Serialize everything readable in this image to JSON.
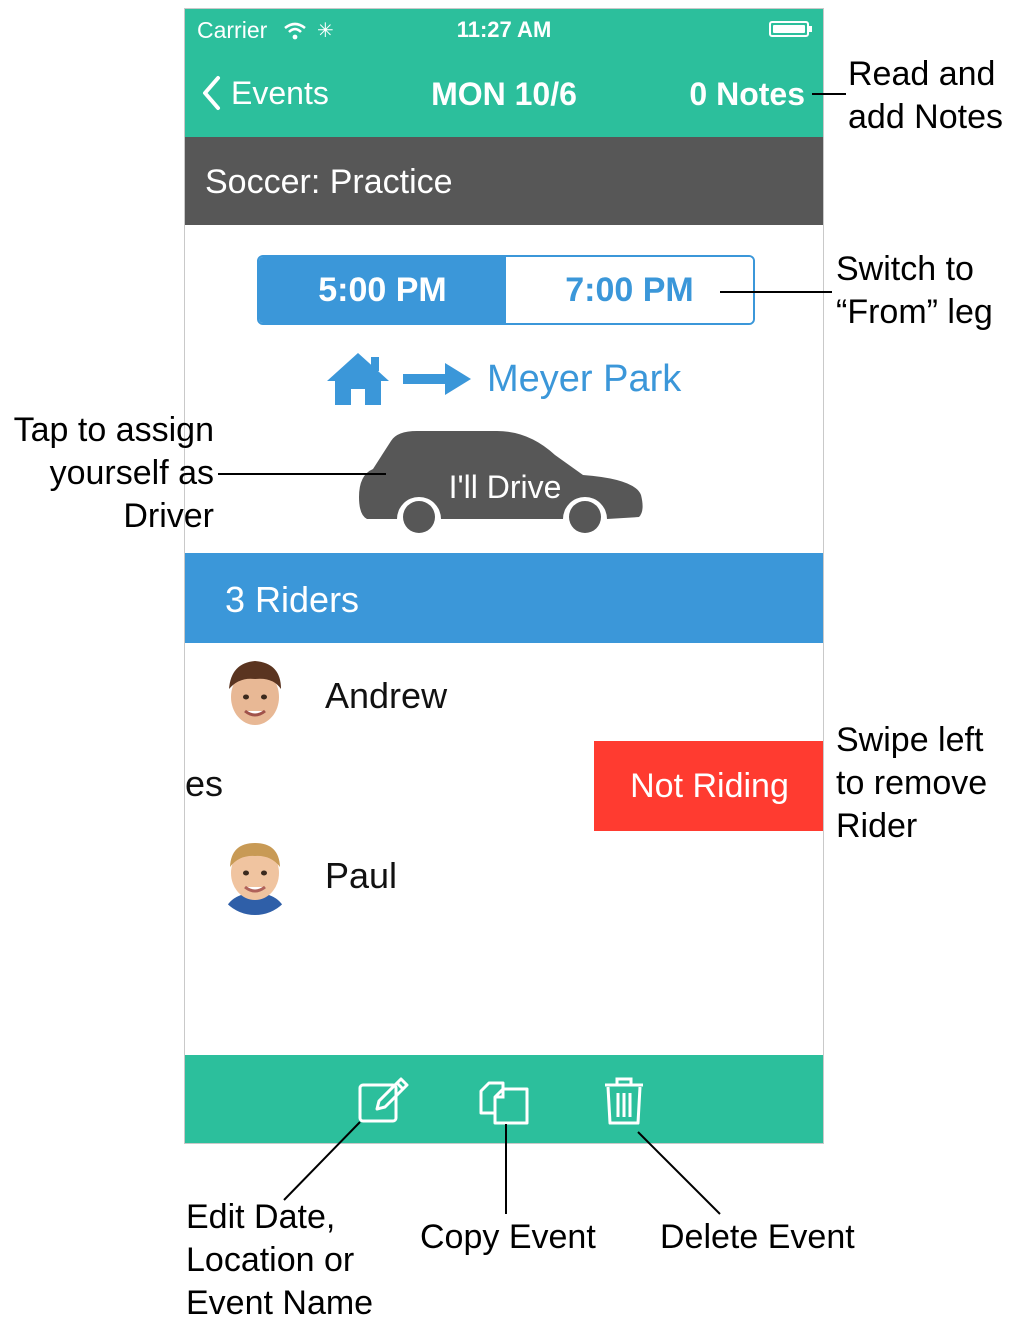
{
  "status_bar": {
    "carrier": "Carrier",
    "time": "11:27 AM"
  },
  "nav": {
    "back_label": "Events",
    "title": "MON 10/6",
    "notes_label": "0 Notes"
  },
  "event": {
    "name": "Soccer: Practice"
  },
  "legs": {
    "to_time": "5:00 PM",
    "from_time": "7:00 PM"
  },
  "route": {
    "destination": "Meyer Park"
  },
  "driver": {
    "button_label": "I'll Drive"
  },
  "riders": {
    "header": "3 Riders",
    "list": [
      {
        "name": "Andrew"
      },
      {
        "name": "es"
      },
      {
        "name": "Paul"
      }
    ],
    "swipe_action": "Not Riding"
  },
  "toolbar": {
    "edit_icon": "edit-icon",
    "copy_icon": "copy-icon",
    "delete_icon": "trash-icon"
  },
  "annotations": {
    "notes": [
      "Read and",
      "add Notes"
    ],
    "switch": [
      "Switch to",
      "“From” leg"
    ],
    "driver": [
      "Tap to assign",
      "yourself as",
      "Driver"
    ],
    "swipe": [
      "Swipe left",
      "to remove",
      "Rider"
    ],
    "edit": [
      "Edit Date,",
      "Location or",
      "Event Name"
    ],
    "copy": "Copy Event",
    "delete": "Delete Event"
  },
  "colors": {
    "teal": "#2cbf9c",
    "blue": "#3b97d9",
    "gray": "#575757",
    "red": "#ff3b30"
  }
}
